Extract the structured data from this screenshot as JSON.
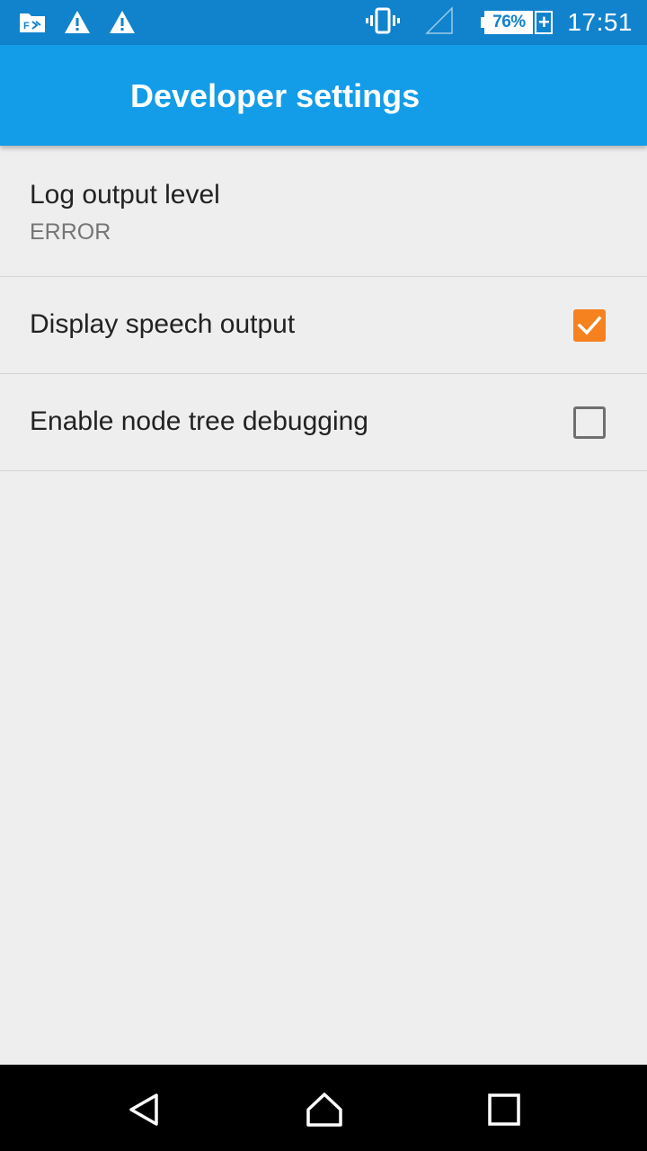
{
  "status_bar": {
    "icons": [
      "file-manager-notification-icon",
      "warning-icon",
      "warning-icon",
      "vibrate-icon",
      "no-signal-icon",
      "battery-icon"
    ],
    "battery_text": "76%",
    "charging_symbol": "+",
    "time": "17:51"
  },
  "app_bar": {
    "title": "Developer settings",
    "color": "#139ce8"
  },
  "preferences": {
    "log_level": {
      "title": "Log output level",
      "summary": "ERROR"
    },
    "speech_output": {
      "title": "Display speech output",
      "checked": true
    },
    "node_tree": {
      "title": "Enable node tree debugging",
      "checked": false
    }
  },
  "accent_color": "#f5811f",
  "nav_bar": {
    "icons": [
      "back-icon",
      "home-icon",
      "recents-icon"
    ]
  }
}
